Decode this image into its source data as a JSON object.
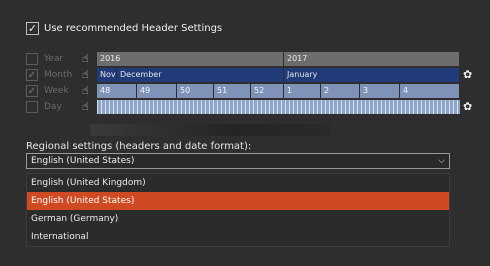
{
  "header_settings": {
    "label": "Use recommended Header Settings",
    "checked": true
  },
  "scale_rows": [
    {
      "key": "year",
      "label": "Year",
      "checked": false,
      "cells": [
        "2016",
        "2017"
      ]
    },
    {
      "key": "month",
      "label": "Month",
      "checked": true,
      "cells": [
        "Nov",
        "December",
        "January"
      ]
    },
    {
      "key": "week",
      "label": "Week",
      "checked": true,
      "cells": [
        "48",
        "49",
        "50",
        "51",
        "52",
        "1",
        "2",
        "3",
        "4"
      ]
    },
    {
      "key": "day",
      "label": "Day",
      "checked": false,
      "cells": []
    }
  ],
  "regional": {
    "label": "Regional settings (headers and date format):",
    "selected": "English (United States)",
    "options": [
      "English (United Kingdom)",
      "English (United States)",
      "German (Germany)",
      "International"
    ]
  },
  "colors": {
    "selected_option": "#cf4a23",
    "month_bar": "#203a7a",
    "week_bar": "#7f93b8",
    "year_bar": "#6d6d6d"
  },
  "icons": {
    "check": "checkmark-icon",
    "hand": "hand-pointer-icon",
    "gear": "gear-icon",
    "chevron": "chevron-down-icon"
  }
}
